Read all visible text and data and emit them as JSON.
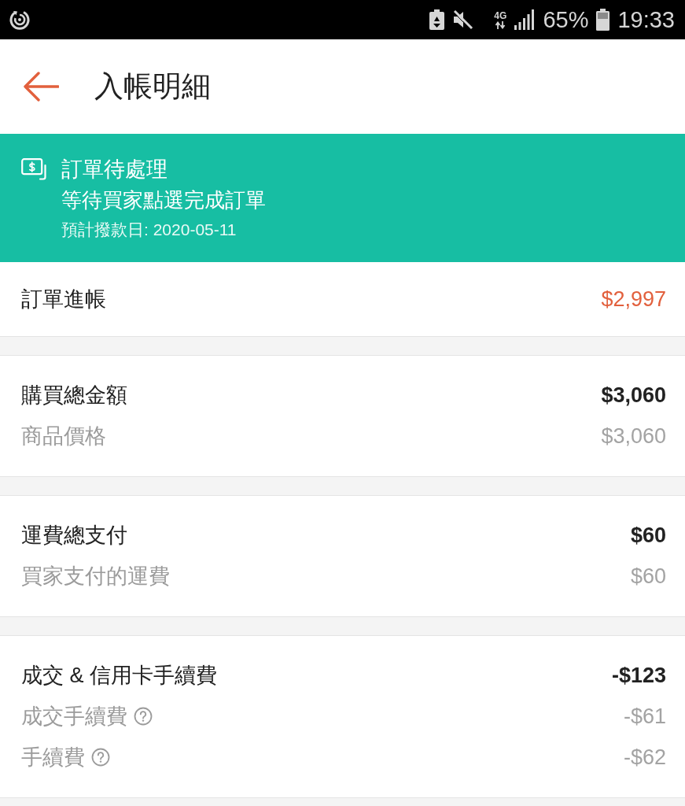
{
  "status_bar": {
    "network": "4G",
    "battery": "65%",
    "time": "19:33"
  },
  "header": {
    "title": "入帳明細"
  },
  "banner": {
    "title": "訂單待處理",
    "subtitle": "等待買家點選完成訂單",
    "note": "預計撥款日: 2020-05-11"
  },
  "sections": [
    {
      "rows": [
        {
          "kind": "net",
          "label": "訂單進帳",
          "amount": "$2,997",
          "help": false
        }
      ]
    },
    {
      "rows": [
        {
          "kind": "total",
          "label": "購買總金額",
          "amount": "$3,060",
          "help": false
        },
        {
          "kind": "detail",
          "label": "商品價格",
          "amount": "$3,060",
          "help": false
        }
      ]
    },
    {
      "rows": [
        {
          "kind": "total",
          "label": "運費總支付",
          "amount": "$60",
          "help": false
        },
        {
          "kind": "detail",
          "label": "買家支付的運費",
          "amount": "$60",
          "help": false
        }
      ]
    },
    {
      "rows": [
        {
          "kind": "total",
          "label": "成交 & 信用卡手續費",
          "amount": "-$123",
          "help": false
        },
        {
          "kind": "detail",
          "label": "成交手續費",
          "amount": "-$61",
          "help": true
        },
        {
          "kind": "detail",
          "label": "手續費",
          "amount": "-$62",
          "help": true
        }
      ]
    }
  ]
}
